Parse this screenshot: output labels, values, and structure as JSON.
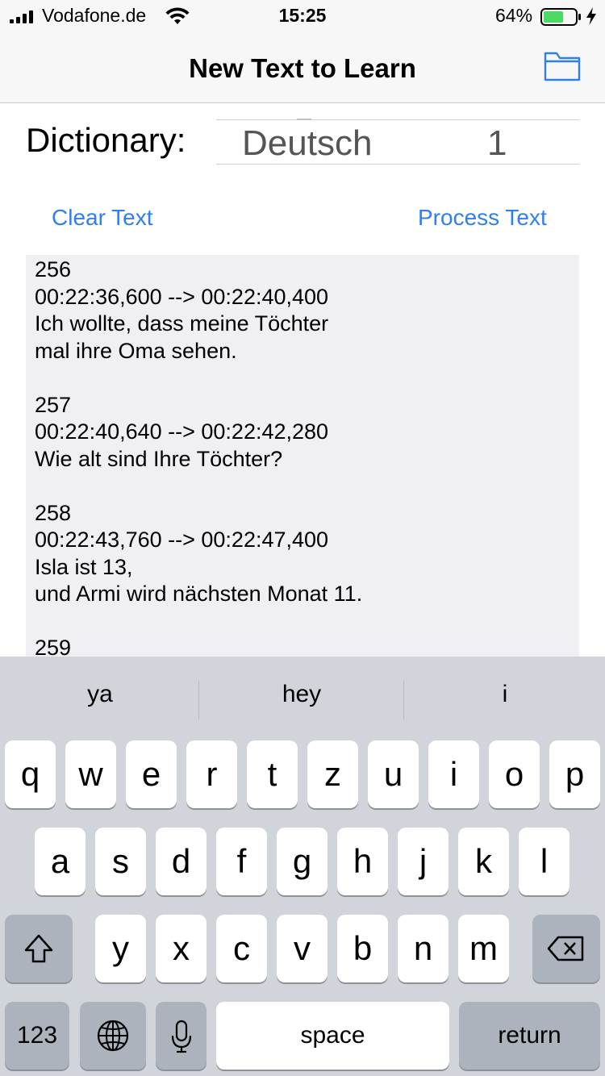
{
  "status_bar": {
    "carrier": "Vodafone.de",
    "time": "15:25",
    "battery_percent": "64%",
    "battery_level": 0.64,
    "charging": true
  },
  "nav": {
    "title": "New Text to Learn",
    "folder_icon": "folder-icon"
  },
  "dictionary": {
    "label": "Dictionary:",
    "language": "Deutsch",
    "number": "1"
  },
  "actions": {
    "clear": "Clear Text",
    "process": "Process Text"
  },
  "text_content": {
    "lines": [
      "256",
      "00:22:36,600 --> 00:22:40,400",
      "Ich wollte, dass meine Töchter",
      "mal ihre Oma sehen.",
      "",
      "257",
      "00:22:40,640 --> 00:22:42,280",
      "Wie alt sind Ihre Töchter?",
      "",
      "258",
      "00:22:43,760 --> 00:22:47,400",
      "Isla ist 13,",
      "und Armi wird nächsten Monat 11.",
      "",
      "259"
    ]
  },
  "keyboard": {
    "suggestions": [
      "ya",
      "hey",
      "i"
    ],
    "row1": [
      "q",
      "w",
      "e",
      "r",
      "t",
      "z",
      "u",
      "i",
      "o",
      "p"
    ],
    "row2": [
      "a",
      "s",
      "d",
      "f",
      "g",
      "h",
      "j",
      "k",
      "l"
    ],
    "row3": [
      "y",
      "x",
      "c",
      "v",
      "b",
      "n",
      "m"
    ],
    "numbers_key": "123",
    "space_key": "space",
    "return_key": "return"
  }
}
